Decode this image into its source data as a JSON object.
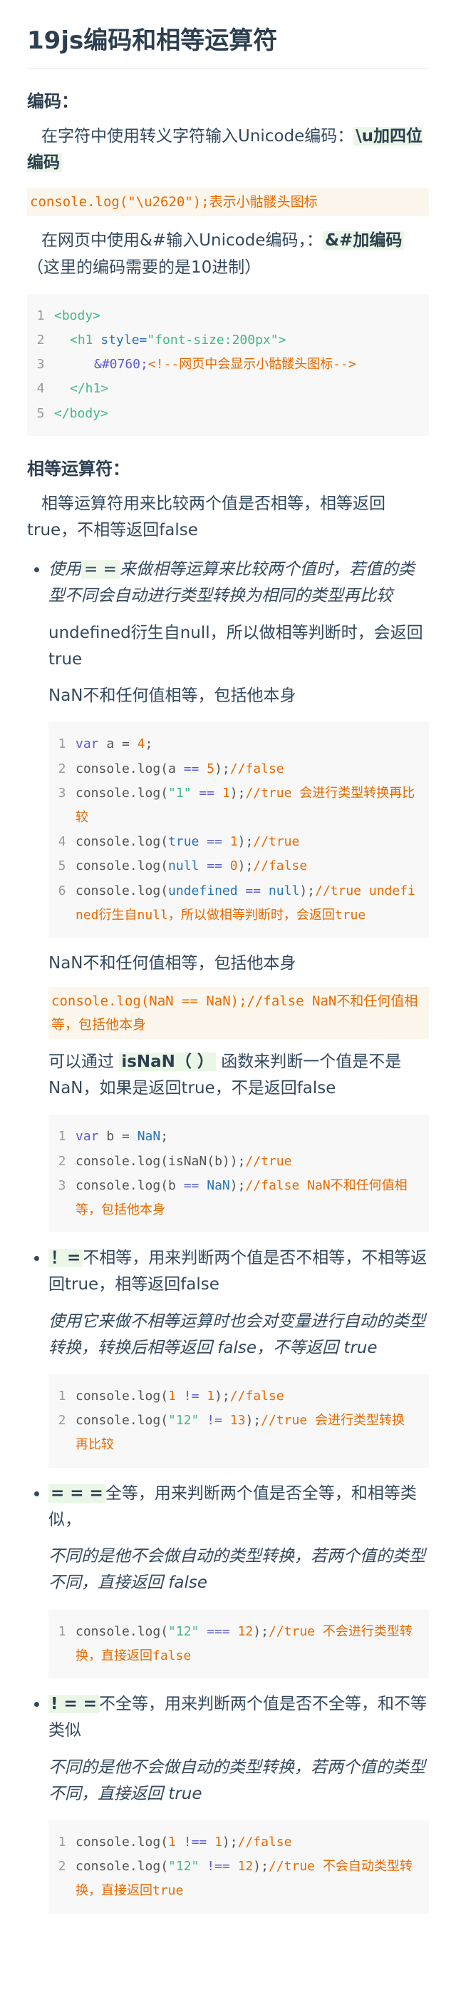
{
  "title": "19js编码和相等运算符",
  "sec1": {
    "heading": "编码：",
    "p1_text": "在字符中使用转义字符输入Unicode编码：",
    "p1_mark": "\\u加四位编码",
    "code_inline": "console.log(\"\\u2620\");表示小骷髅头图标",
    "p2_text": "在网页中使用&#输入Unicode编码，：",
    "p2_mark": "&#加编码",
    "p2_tail": "（这里的编码需要的是10进制）",
    "html_code": {
      "nums": [
        "1",
        "2",
        "3",
        "4",
        "5"
      ],
      "l1": "<body>",
      "l2_open": "<h1",
      "l2_attr": " style=",
      "l2_val": "\"font-size:200px\"",
      "l2_close": ">",
      "l3_ent": "&#0760;",
      "l3_comment": "<!--网页中会显示小骷髅头图标-->",
      "l4": "</h1>",
      "l5": "</body>"
    }
  },
  "sec2": {
    "heading": "相等运算符：",
    "intro": "相等运算符用来比较两个值是否相等，相等返回true，不相等返回false",
    "item1": {
      "em_a": "使用",
      "mark": "= =",
      "em_b": "来做相等运算来比较两个值时，若值的类型不同会自动进行类型转换为相同的类型再比较",
      "p_undef": "undefined衍生自null，所以做相等判断时，会返回true",
      "p_nan": "NaN不和任何值相等，包括他本身",
      "code1": {
        "n1": "1",
        "n2": "2",
        "n3": "3",
        "n4": "4",
        "n5": "5",
        "n6": "6",
        "l1_kw": "var",
        "l1_mid": " a = ",
        "l1_num": "4",
        "l1_end": ";",
        "l2_a": "console.log(a ",
        "l2_op": "==",
        "l2_sp": " ",
        "l2_num": "5",
        "l2_b": ");",
        "l2_c": "//false",
        "l3_a": "console.log(",
        "l3_str": "\"1\"",
        "l3_op": " == ",
        "l3_num": "1",
        "l3_b": ");",
        "l3_c": "//true  会进行类型转换再比较",
        "l4_a": "console.log(",
        "l4_kw": "true",
        "l4_op": " == ",
        "l4_num": "1",
        "l4_b": ");",
        "l4_c": "//true",
        "l5_a": "console.log(",
        "l5_kw": "null",
        "l5_op": " == ",
        "l5_num": "0",
        "l5_b": ");",
        "l5_c": "//false",
        "l6_a": "console.log(",
        "l6_kw": "undefined",
        "l6_op": " == ",
        "l6_kw2": "null",
        "l6_b": ");",
        "l6_c": "//true undefined衍生自null，所以做相等判断时，会返回true"
      },
      "p_nan2": "NaN不和任何值相等，包括他本身",
      "code_inline2": "console.log(NaN == NaN);//false    NaN不和任何值相等，包括他本身",
      "p_isnan_a": "可以通过 ",
      "p_isnan_b": "isNaN（ ）",
      "p_isnan_c": " 函数来判断一个值是不是NaN，如果是返回true，不是返回false",
      "code2": {
        "n1": "1",
        "n2": "2",
        "n3": "3",
        "l1_kw": "var",
        "l1_mid": " b = ",
        "l1_kw2": "NaN",
        "l1_end": ";",
        "l2_a": "console.log(isNaN(b));",
        "l2_c": "//true",
        "l3_a": "console.log(b ",
        "l3_op": "==",
        "l3_sp": " ",
        "l3_kw": "NaN",
        "l3_b": ");",
        "l3_c": "//false    NaN不和任何值相等，包括他本身"
      }
    },
    "item2": {
      "mark": "！=",
      "text": "不相等，用来判断两个值是否不相等，不相等返回true，相等返回false",
      "em": "使用它来做不相等运算时也会对变量进行自动的类型转换，转换后相等返回 false，不等返回 true",
      "code": {
        "n1": "1",
        "n2": "2",
        "l1_a": "console.log(",
        "l1_num": "1",
        "l1_op": " != ",
        "l1_num2": "1",
        "l1_b": ");",
        "l1_c": "//false",
        "l2_a": "console.log(",
        "l2_str": "\"12\"",
        "l2_op": " != ",
        "l2_num": "13",
        "l2_b": ");",
        "l2_c": "//true  会进行类型转换再比较"
      }
    },
    "item3": {
      "mark": "= = =",
      "text": "全等，用来判断两个值是否全等，和相等类似，",
      "em": "不同的是他不会做自动的类型转换，若两个值的类型不同，直接返回 false",
      "code": {
        "n1": "1",
        "l1_a": "console.log(",
        "l1_str": "\"12\"",
        "l1_op": " === ",
        "l1_num": "12",
        "l1_b": ");",
        "l1_c": "//true 不会进行类型转换，直接返回false"
      }
    },
    "item4": {
      "mark": "! = =",
      "text": "不全等，用来判断两个值是否不全等，和不等类似",
      "em": "不同的是他不会做自动的类型转换，若两个值的类型不同，直接返回 true",
      "code": {
        "n1": "1",
        "n2": "2",
        "l1_a": "console.log(",
        "l1_num": "1",
        "l1_op": " !== ",
        "l1_num2": "1",
        "l1_b": ");",
        "l1_c": "//false",
        "l2_a": "console.log(",
        "l2_str": "\"12\"",
        "l2_op": " !== ",
        "l2_num": "12",
        "l2_b": ");",
        "l2_c": "//true  不会自动类型转换，直接返回true"
      }
    }
  }
}
